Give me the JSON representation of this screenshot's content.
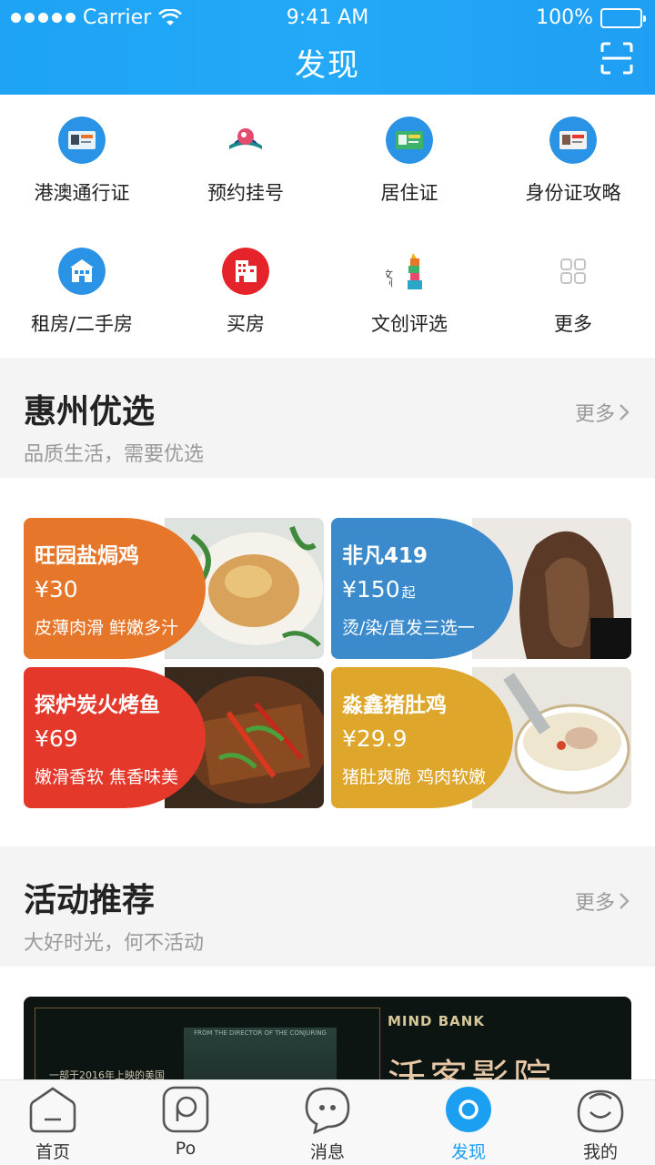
{
  "status_bar": {
    "carrier": "Carrier",
    "time": "9:41 AM",
    "battery": "100%"
  },
  "header": {
    "title": "发现",
    "scan_icon": "scan-icon"
  },
  "services": [
    {
      "label": "港澳通行证",
      "icon": "hk-macau-pass-icon",
      "color": "#2a93e6"
    },
    {
      "label": "预约挂号",
      "icon": "appointment-icon",
      "color": "#e54b6d"
    },
    {
      "label": "居住证",
      "icon": "residence-permit-icon",
      "color": "#2a93e6"
    },
    {
      "label": "身份证攻略",
      "icon": "id-card-icon",
      "color": "#2a93e6"
    },
    {
      "label": "租房/二手房",
      "icon": "rent-house-icon",
      "color": "#2a93e6"
    },
    {
      "label": "买房",
      "icon": "buy-house-icon",
      "color": "#e5232b"
    },
    {
      "label": "文创评选",
      "icon": "cultural-creative-icon",
      "color": "#e9b51e",
      "icon_text": "文创"
    },
    {
      "label": "更多",
      "icon": "more-grid-icon",
      "color": "#c4c4c4"
    }
  ],
  "section_picks": {
    "title": "惠州优选",
    "subtitle": "品质生活，需要优选",
    "more": "更多"
  },
  "cards": [
    {
      "name": "旺园盐焗鸡",
      "price": "¥30",
      "price_suffix": "",
      "desc": "皮薄肉滑 鲜嫩多汁",
      "color": "#e5762a"
    },
    {
      "name": "非凡419",
      "price": "¥150",
      "price_suffix": "起",
      "desc": "烫/染/直发三选一",
      "color": "#3b8bcc"
    },
    {
      "name": "探炉炭火烤鱼",
      "price": "¥69",
      "price_suffix": "",
      "desc": "嫩滑香软 焦香味美",
      "color": "#e4382b"
    },
    {
      "name": "淼鑫猪肚鸡",
      "price": "¥29.9",
      "price_suffix": "",
      "desc": "猪肚爽脆 鸡肉软嫩",
      "color": "#dea62a"
    }
  ],
  "section_activities": {
    "title": "活动推荐",
    "subtitle": "大好时光，何不活动",
    "more": "更多"
  },
  "banner": {
    "intro": "一部于2016年上映的美国",
    "poster_text": "FROM THE DIRECTOR OF THE CONJURING",
    "brand": "MIND BANK",
    "headline": "沃客影院"
  },
  "tabbar": [
    {
      "label": "首页",
      "icon": "home-icon",
      "active": false
    },
    {
      "label": "Po",
      "icon": "po-icon",
      "active": false
    },
    {
      "label": "消息",
      "icon": "message-icon",
      "active": false
    },
    {
      "label": "发现",
      "icon": "discover-icon",
      "active": true
    },
    {
      "label": "我的",
      "icon": "profile-icon",
      "active": false
    }
  ],
  "colors": {
    "primary": "#1ea3f5",
    "section_bg": "#f4f4f4",
    "muted_text": "#9a9a9a"
  }
}
